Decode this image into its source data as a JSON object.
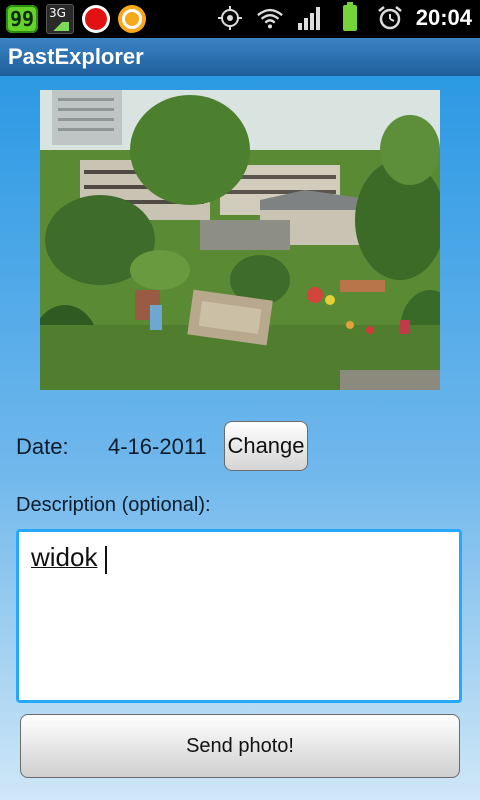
{
  "status_bar": {
    "badge_99": "99",
    "network_label": "3G",
    "time": "20:04",
    "icons": [
      "battery-level-badge-icon",
      "3g-data-icon",
      "record-icon",
      "orange-app-icon",
      "gps-icon",
      "wifi-icon",
      "signal-icon",
      "battery-icon",
      "alarm-icon"
    ]
  },
  "app": {
    "title": "PastExplorer"
  },
  "form": {
    "date_label": "Date:",
    "date_value": "4-16-2011",
    "change_button": "Change",
    "description_label": "Description (optional):",
    "description_value": "widok",
    "send_button": "Send photo!"
  },
  "colors": {
    "title_bar": "#2a6fb0",
    "background_top": "#2c99e4",
    "background_bottom": "#cfe7f7",
    "input_focus": "#27a8ff"
  }
}
